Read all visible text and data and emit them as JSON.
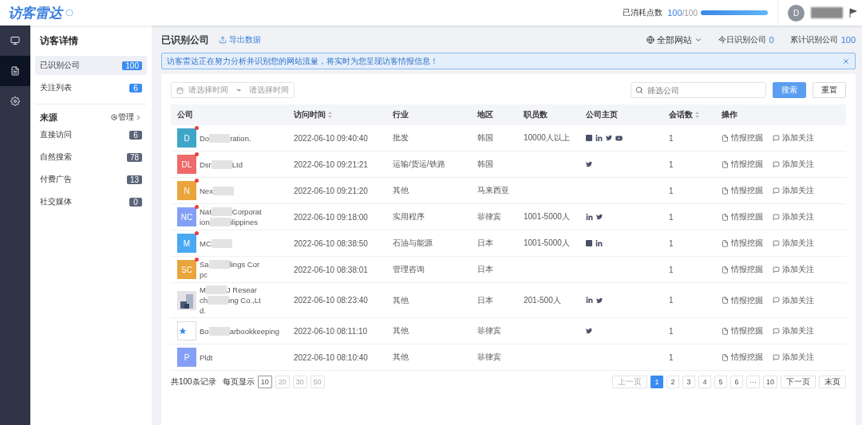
{
  "header": {
    "logo": "访客雷达",
    "points_label": "已消耗点数",
    "points_used": "100",
    "points_total": "/100",
    "points_bar": {
      "level": 1
    },
    "avatar": "D"
  },
  "rail": [
    {
      "kind": "monitor",
      "selected": false
    },
    {
      "kind": "document",
      "selected": true
    },
    {
      "kind": "gear",
      "selected": false
    }
  ],
  "sidebar": {
    "title": "访客详情",
    "items": [
      {
        "label": "已识别公司",
        "count": "100",
        "selected": true
      },
      {
        "label": "关注列表",
        "count": "6",
        "selected": false
      }
    ],
    "source_title": "来源",
    "manage": "管理",
    "sources": [
      {
        "label": "直接访问",
        "count": "6"
      },
      {
        "label": "自然搜索",
        "count": "78"
      },
      {
        "label": "付费广告",
        "count": "13"
      },
      {
        "label": "社交媒体",
        "count": "0"
      }
    ]
  },
  "page": {
    "title": "已识别公司",
    "export": "导出数据",
    "site_filter": "全部网站",
    "today_label": "今日识别公司",
    "today_value": "0",
    "total_label": "累计识别公司",
    "total_value": "100"
  },
  "notice": "访客雷达正在努力分析并识别您的网站流量，将实时为您呈现访客情报信息！",
  "filters": {
    "date_start": "请选择时间",
    "date_sep": "~",
    "date_end": "请选择时间",
    "search_placeholder": "筛选公司",
    "search_button": "搜索",
    "reset_button": "重置"
  },
  "table": {
    "columns": [
      {
        "label": "公司",
        "sortable": false
      },
      {
        "label": "访问时间",
        "sortable": true
      },
      {
        "label": "行业",
        "sortable": false
      },
      {
        "label": "地区",
        "sortable": false
      },
      {
        "label": "职员数",
        "sortable": false
      },
      {
        "label": "公司主页",
        "sortable": false
      },
      {
        "label": "会话数",
        "sortable": true
      },
      {
        "label": "操作",
        "sortable": false
      }
    ],
    "rows": [
      {
        "logo": {
          "kind": "letter",
          "text": "D",
          "color": "#3fa6c9"
        },
        "unread": true,
        "redacted_tail": false,
        "name_lines": [
          [
            "Do",
            "ration."
          ]
        ],
        "time": "2022-06-10 09:40:40",
        "industry": "批发",
        "region": "韩国",
        "staff": "10000人以上",
        "links": [
          {
            "kind": "site"
          },
          {
            "kind": "linkedin"
          },
          {
            "kind": "twitter"
          },
          {
            "kind": "youtube"
          }
        ],
        "sessions": "1",
        "actions": [
          "情报挖掘",
          "添加关注"
        ]
      },
      {
        "logo": {
          "kind": "letter",
          "text": "DL",
          "color": "#ee6a6a"
        },
        "unread": true,
        "redacted_tail": false,
        "name_lines": [
          [
            "Dsr",
            "Ltd"
          ]
        ],
        "time": "2022-06-10 09:21:21",
        "industry": "运输/货运/铁路",
        "region": "韩国",
        "links": [
          {
            "kind": "twitter"
          }
        ],
        "sessions": "1",
        "actions": [
          "情报挖掘",
          "添加关注"
        ]
      },
      {
        "logo": {
          "kind": "letter",
          "text": "N",
          "color": "#e9a53c"
        },
        "unread": true,
        "redacted_tail": true,
        "name_lines": [
          [
            "Nex"
          ]
        ],
        "time": "2022-06-10 09:21:20",
        "industry": "其他",
        "region": "马来西亚",
        "links": [],
        "sessions": "1",
        "actions": [
          "情报挖掘",
          "添加关注"
        ]
      },
      {
        "logo": {
          "kind": "letter",
          "text": "NC",
          "color": "#84a0f6"
        },
        "unread": true,
        "redacted_tail": false,
        "name_lines": [
          [
            "Nat",
            "Corporat"
          ],
          [
            "ion",
            "ilippines"
          ]
        ],
        "time": "2022-06-10 09:18:00",
        "industry": "实用程序",
        "region": "菲律宾",
        "staff": "1001-5000人",
        "links": [
          {
            "kind": "linkedin"
          },
          {
            "kind": "twitter"
          }
        ],
        "sessions": "1",
        "actions": [
          "情报挖掘",
          "添加关注"
        ]
      },
      {
        "logo": {
          "kind": "letter",
          "text": "M",
          "color": "#4aa9f2"
        },
        "unread": true,
        "redacted_tail": true,
        "name_lines": [
          [
            "MC"
          ]
        ],
        "time": "2022-06-10 08:38:50",
        "industry": "石油与能源",
        "region": "日本",
        "staff": "1001-5000人",
        "links": [
          {
            "kind": "site"
          },
          {
            "kind": "linkedin"
          }
        ],
        "sessions": "1",
        "actions": [
          "情报挖掘",
          "添加关注"
        ]
      },
      {
        "logo": {
          "kind": "letter",
          "text": "SC",
          "color": "#e9a53c"
        },
        "unread": true,
        "redacted_tail": false,
        "name_lines": [
          [
            "Sa",
            "lings Cor"
          ],
          [
            "pc"
          ]
        ],
        "time": "2022-06-10 08:38:01",
        "industry": "管理咨询",
        "region": "日本",
        "links": [],
        "sessions": "1",
        "actions": [
          "情报挖掘",
          "添加关注"
        ]
      },
      {
        "logo": {
          "kind": "picture"
        },
        "unread": false,
        "redacted_tail": false,
        "name_lines": [
          [
            "M",
            "J Resear"
          ],
          [
            "ch",
            "ing Co.,Lt"
          ],
          [
            "d."
          ]
        ],
        "time": "2022-06-10 08:23:40",
        "industry": "其他",
        "region": "日本",
        "staff": "201-500人",
        "links": [
          {
            "kind": "linkedin"
          },
          {
            "kind": "twitter"
          }
        ],
        "sessions": "1",
        "actions": [
          "情报挖掘",
          "添加关注"
        ]
      },
      {
        "logo": {
          "kind": "star"
        },
        "unread": false,
        "redacted_tail": false,
        "name_lines": [
          [
            "Bo",
            "arbookkeeping"
          ]
        ],
        "time": "2022-06-10 08:11:10",
        "industry": "其他",
        "region": "菲律宾",
        "links": [
          {
            "kind": "twitter"
          }
        ],
        "sessions": "1",
        "actions": [
          "情报挖掘",
          "添加关注"
        ]
      },
      {
        "logo": {
          "kind": "letter",
          "text": "P",
          "color": "#84a0f6"
        },
        "unread": false,
        "redacted_tail": false,
        "name_lines": [
          [
            "Pldt"
          ]
        ],
        "time": "2022-06-10 08:10:40",
        "industry": "其他",
        "region": "菲律宾",
        "links": [],
        "sessions": "1",
        "actions": [
          "情报挖掘",
          "添加关注"
        ]
      }
    ]
  },
  "footer": {
    "total": "共100条记录",
    "per_page_label": "每页显示",
    "per_page": [
      {
        "label": "10",
        "selected": true
      },
      {
        "label": "20",
        "selected": false
      },
      {
        "label": "30",
        "selected": false
      },
      {
        "label": "50",
        "selected": false
      }
    ],
    "prev": "上一页",
    "pages": [
      {
        "label": "1",
        "selected": true
      },
      {
        "label": "2",
        "selected": false
      },
      {
        "label": "3",
        "selected": false
      },
      {
        "label": "4",
        "selected": false
      },
      {
        "label": "5",
        "selected": false
      },
      {
        "label": "6",
        "selected": false
      },
      {
        "label": "···",
        "selected": false
      },
      {
        "label": "10",
        "selected": false
      }
    ],
    "next": "下一页",
    "last": "末页"
  }
}
